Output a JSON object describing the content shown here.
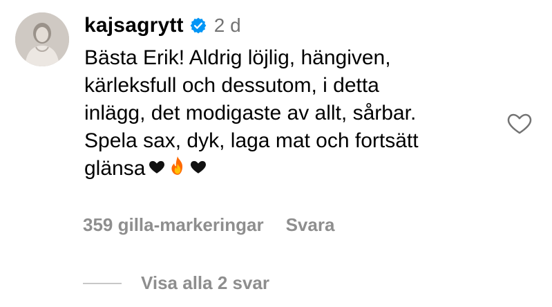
{
  "comment": {
    "username": "kajsagrytt",
    "verified_icon": "verified-badge-icon",
    "timestamp": "2 d",
    "text_lines": [
      "Bästa Erik! Aldrig löjlig, hängiven,",
      "kärleksfull och dessutom, i detta",
      "inlägg, det modigaste av allt, sårbar.",
      "Spela sax, dyk, laga mat och fortsätt",
      "glänsa"
    ],
    "emojis": [
      "black-heart-icon",
      "fire-icon",
      "black-heart-icon"
    ],
    "likes": "359 gilla-markeringar",
    "reply_label": "Svara",
    "view_replies": "Visa alla 2 svar",
    "like_icon": "heart-outline-icon"
  },
  "colors": {
    "text": "#000000",
    "secondary": "#737373",
    "muted": "#8e8e8e",
    "verified": "#0095f6",
    "divider": "#c7c7c7"
  }
}
